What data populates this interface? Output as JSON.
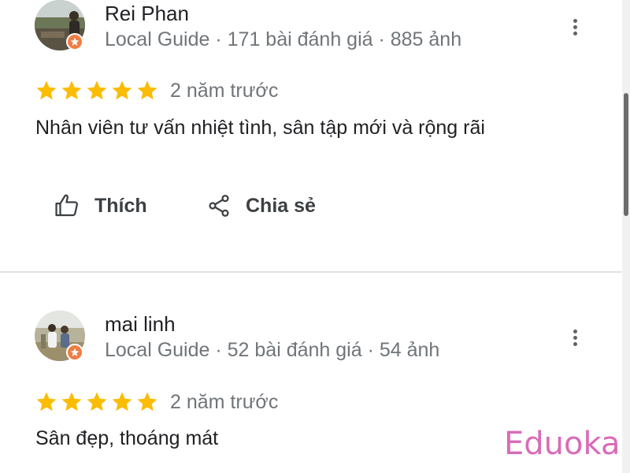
{
  "reviews": [
    {
      "name": "Rei Phan",
      "meta": "Local Guide · 171 bài đánh giá · 885 ảnh",
      "rating": 5,
      "time": "2 năm trước",
      "text": "Nhân viên tư vấn nhiệt tình, sân tập mới và rộng rãi",
      "avatar_icon": "profile-photo",
      "badge_icon": "local-guide-star-icon"
    },
    {
      "name": "mai linh",
      "meta": "Local Guide · 52 bài đánh giá · 54 ảnh",
      "rating": 5,
      "time": "2 năm trước",
      "text": "Sân đẹp, thoáng mát",
      "avatar_icon": "profile-photo",
      "badge_icon": "local-guide-star-icon"
    }
  ],
  "actions": {
    "like_label": "Thích",
    "share_label": "Chia sẻ",
    "like_icon": "thumbs-up-icon",
    "share_icon": "share-icon",
    "more_icon": "more-vert-icon"
  },
  "watermark": "Eduoka",
  "colors": {
    "star": "#fbbc04",
    "badge": "#ef7d44",
    "meta_text": "#70757a",
    "watermark": "#d96bb8"
  }
}
